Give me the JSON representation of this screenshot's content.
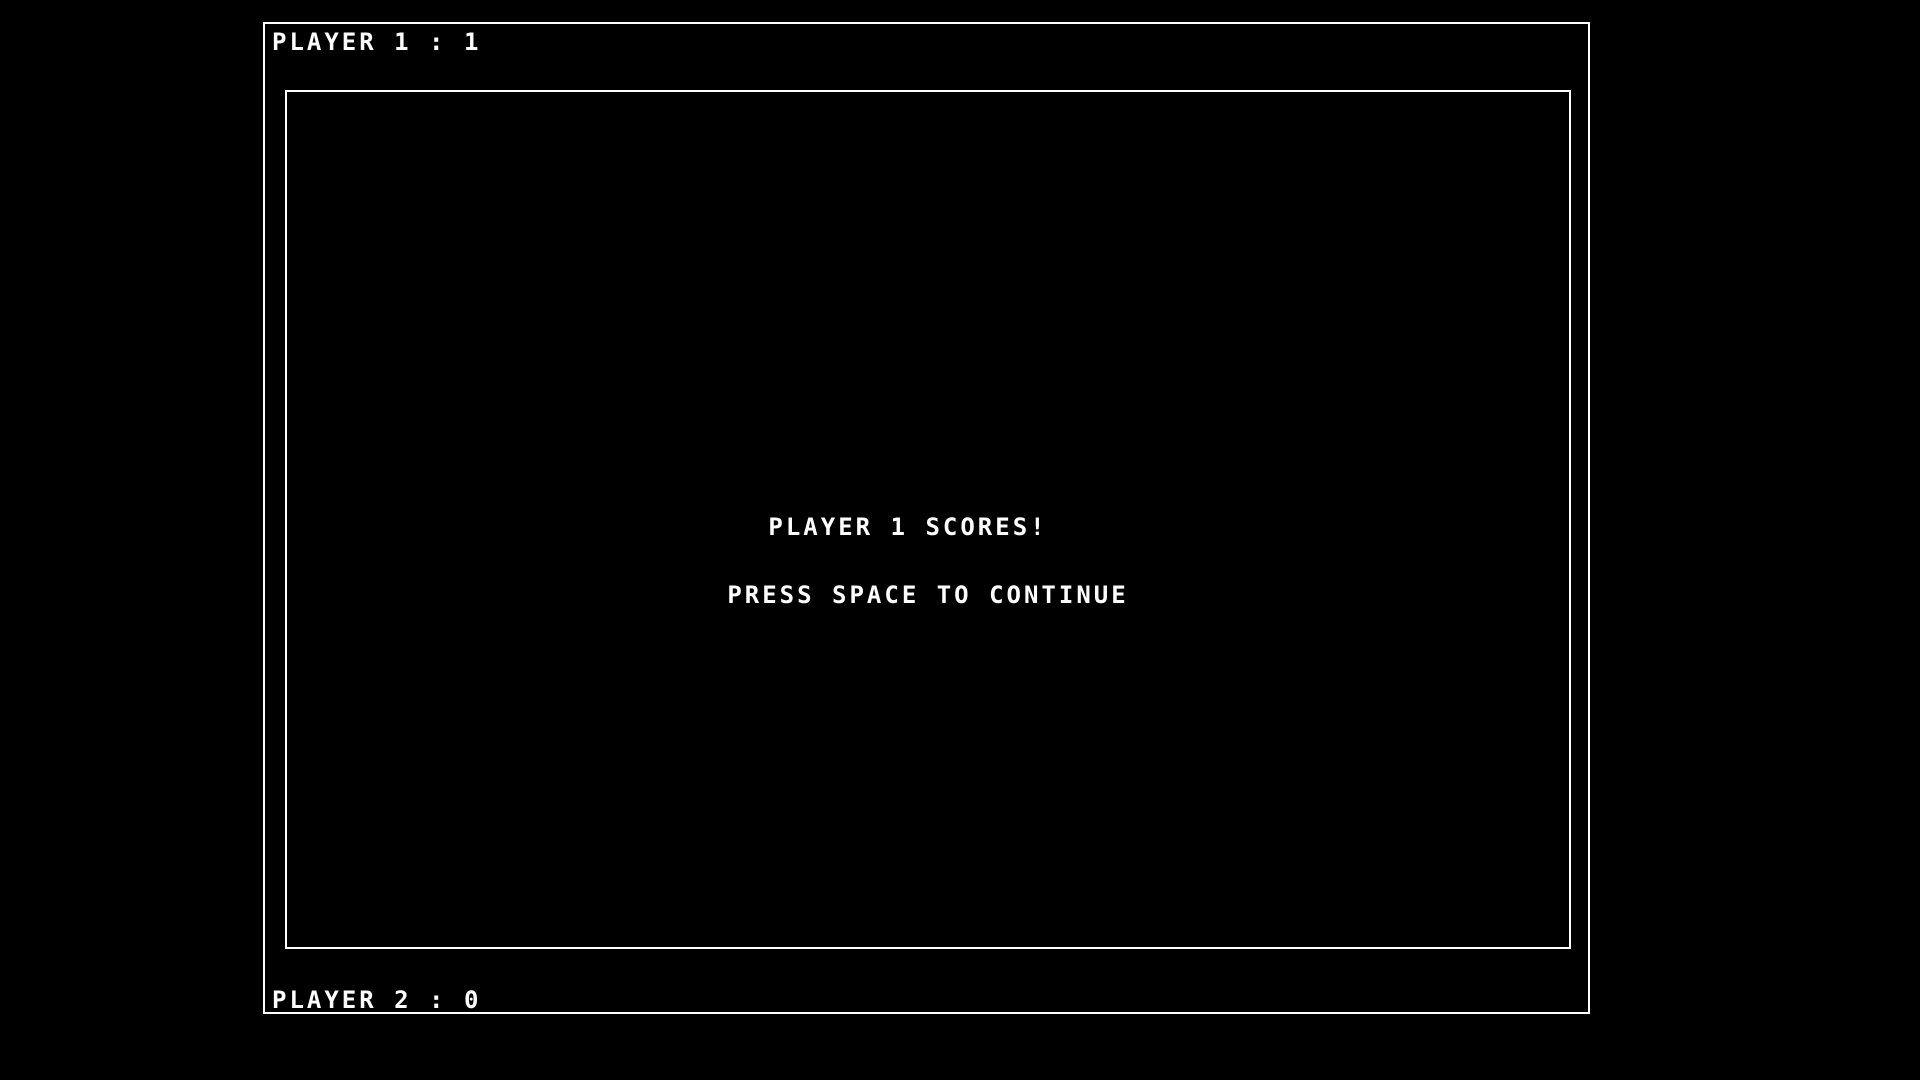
{
  "scoreboard": {
    "player1_label": "PLAYER 1 : 1",
    "player2_label": "PLAYER 2 : 0",
    "player1_score": 1,
    "player2_score": 0
  },
  "overlay": {
    "title": "PLAYER 1 SCORES!",
    "prompt": "PRESS SPACE TO CONTINUE"
  },
  "colors": {
    "background": "#000000",
    "foreground": "#ffffff"
  }
}
